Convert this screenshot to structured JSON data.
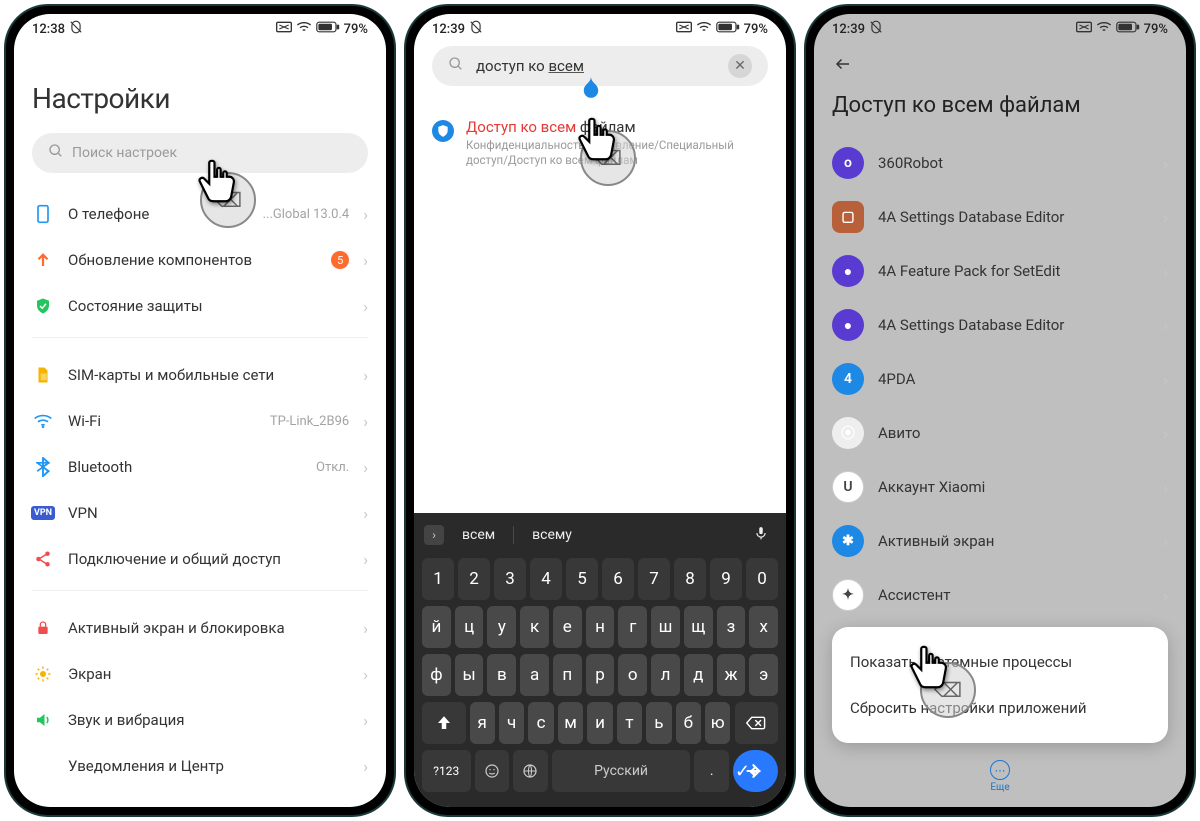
{
  "status": {
    "time1": "12:38",
    "time2": "12:39",
    "time3": "12:39",
    "battery": "79%"
  },
  "p1": {
    "title": "Настройки",
    "search_placeholder": "Поиск настроек",
    "items": [
      {
        "label": "О телефоне",
        "sub": "...Global 13.0.4",
        "icon": "phone-outline",
        "color": "#2196f3"
      },
      {
        "label": "Обновление компонентов",
        "badge": "5",
        "icon": "arrow-up",
        "color": "#ff6b2d"
      },
      {
        "label": "Состояние защиты",
        "icon": "shield-check",
        "color": "#22c55e"
      }
    ],
    "group2": [
      {
        "label": "SIM-карты и мобильные сети",
        "icon": "sim",
        "color": "#f5b400"
      },
      {
        "label": "Wi-Fi",
        "sub": "TP-Link_2B96",
        "icon": "wifi",
        "color": "#2196f3"
      },
      {
        "label": "Bluetooth",
        "sub": "Откл.",
        "icon": "bluetooth",
        "color": "#2196f3"
      },
      {
        "label": "VPN",
        "icon": "vpn",
        "color": "#3b5bd1"
      },
      {
        "label": "Подключение и общий доступ",
        "icon": "share",
        "color": "#f04e4e"
      }
    ],
    "group3": [
      {
        "label": "Активный экран и блокировка",
        "icon": "lock",
        "color": "#f04e4e"
      },
      {
        "label": "Экран",
        "icon": "sun",
        "color": "#f5b400"
      },
      {
        "label": "Звук и вибрация",
        "icon": "speaker",
        "color": "#22c55e"
      },
      {
        "label": "Уведомления и Центр",
        "icon": "",
        "color": ""
      }
    ]
  },
  "p2": {
    "query_match": "доступ ко ",
    "query_und": "всем",
    "result_title_match": "Доступ ко всем",
    "result_title_rest": " файлам",
    "result_sub": "Конфиденциальность/Управление/Специальный доступ/Доступ ко всем файлам",
    "suggest": [
      "всем",
      "всему"
    ],
    "rows": [
      [
        "1",
        "2",
        "3",
        "4",
        "5",
        "6",
        "7",
        "8",
        "9",
        "0"
      ],
      [
        "й",
        "ц",
        "у",
        "к",
        "е",
        "н",
        "г",
        "ш",
        "щ",
        "з",
        "х"
      ],
      [
        "ф",
        "ы",
        "в",
        "а",
        "п",
        "р",
        "о",
        "л",
        "д",
        "ж",
        "э"
      ],
      [
        "я",
        "ч",
        "с",
        "м",
        "и",
        "т",
        "ь",
        "б",
        "ю"
      ]
    ],
    "space_label": "Русский",
    "numkey": "?123"
  },
  "p3": {
    "title": "Доступ ко всем файлам",
    "apps": [
      {
        "label": "360Robot",
        "bg": "#5a3bd1",
        "inner": "o"
      },
      {
        "label": "4A Settings Database Editor",
        "bg": "#b7603a",
        "inner": "▢",
        "square": true
      },
      {
        "label": "4A Feature Pack for SetEdit",
        "bg": "#5a3bd1",
        "inner": "●"
      },
      {
        "label": "4A Settings Database Editor",
        "bg": "#5a3bd1",
        "inner": "●"
      },
      {
        "label": "4PDA",
        "bg": "#1e88e5",
        "inner": "4"
      },
      {
        "label": "Авито",
        "bg": "#eeeeee",
        "inner": "⦿"
      },
      {
        "label": "Аккаунт Xiaomi",
        "bg": "#ffffff",
        "inner": "U",
        "ring": true
      },
      {
        "label": "Активный экран",
        "bg": "#1e88e5",
        "inner": "✱"
      },
      {
        "label": "Ассистент",
        "bg": "#ffffff",
        "inner": "✦",
        "ring": true
      }
    ],
    "menu": [
      "Показать системные процессы",
      "Сбросить настройки приложений"
    ],
    "more": "Еще"
  }
}
